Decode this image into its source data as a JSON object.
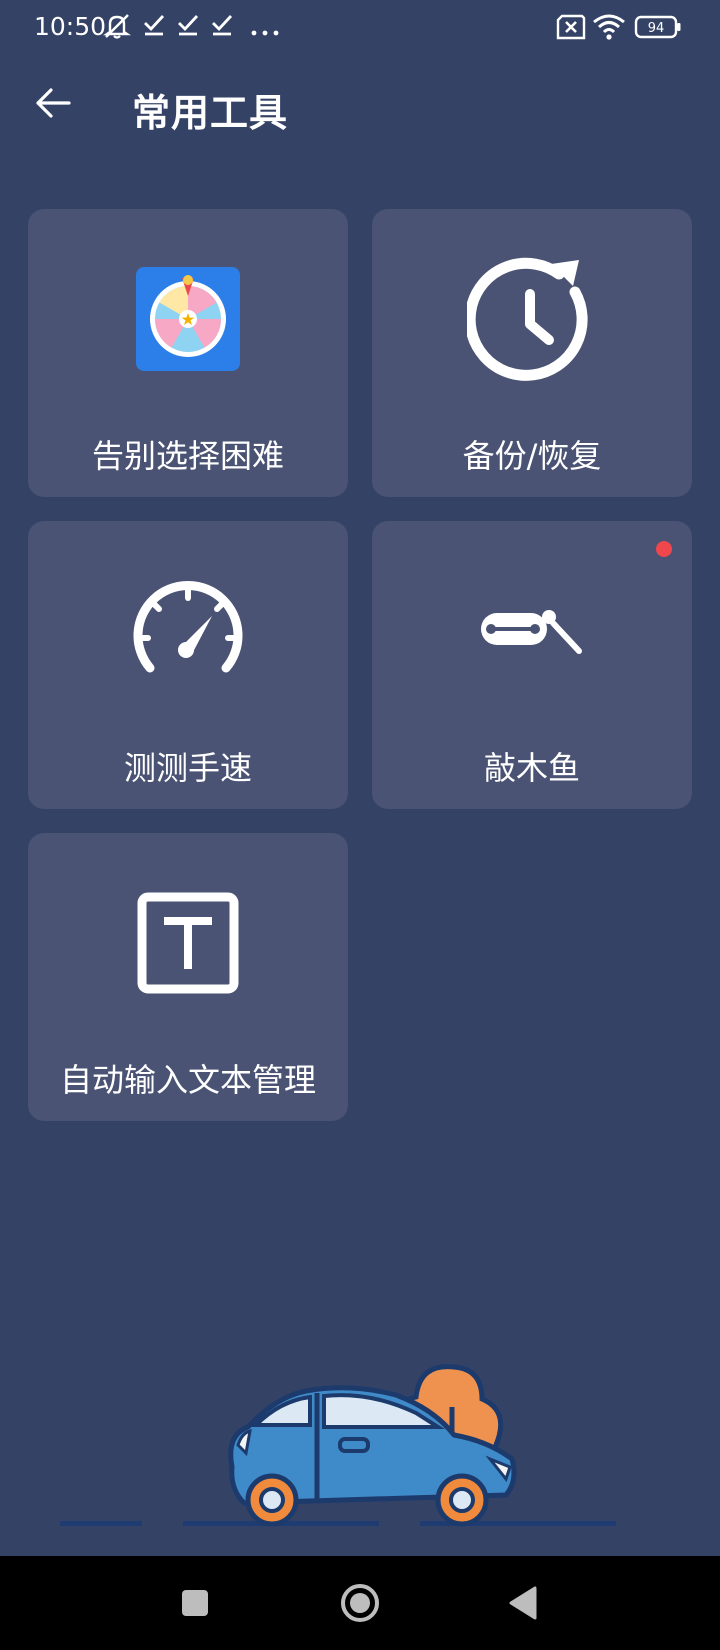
{
  "status_bar": {
    "time": "10:50",
    "battery": "94",
    "icons": [
      "mute-notification-icon",
      "check-icon",
      "check-icon",
      "check-icon",
      "more-dots-icon",
      "sim-x-icon",
      "wifi-icon",
      "battery-icon"
    ]
  },
  "header": {
    "title": "常用工具",
    "back_icon": "arrow-left-icon"
  },
  "tools": [
    {
      "label": "告别选择困难",
      "icon": "lucky-wheel-icon"
    },
    {
      "label": "备份/恢复",
      "icon": "clock-restore-icon"
    },
    {
      "label": "测测手速",
      "icon": "speedometer-icon"
    },
    {
      "label": "敲木鱼",
      "icon": "wooden-fish-icon",
      "badge": true
    },
    {
      "label": "自动输入文本管理",
      "icon": "text-box-icon"
    }
  ],
  "illustration": "car-icon",
  "nav_bar": {
    "buttons": [
      "recent-apps-icon",
      "home-icon",
      "back-triangle-icon"
    ]
  },
  "colors": {
    "background": "#344266",
    "card": "#4a5374",
    "badge": "#f0474d",
    "navbar": "#000000",
    "car_body": "#3f8ac9",
    "car_wheel": "#f08a3c",
    "bush": "#f0924f"
  }
}
